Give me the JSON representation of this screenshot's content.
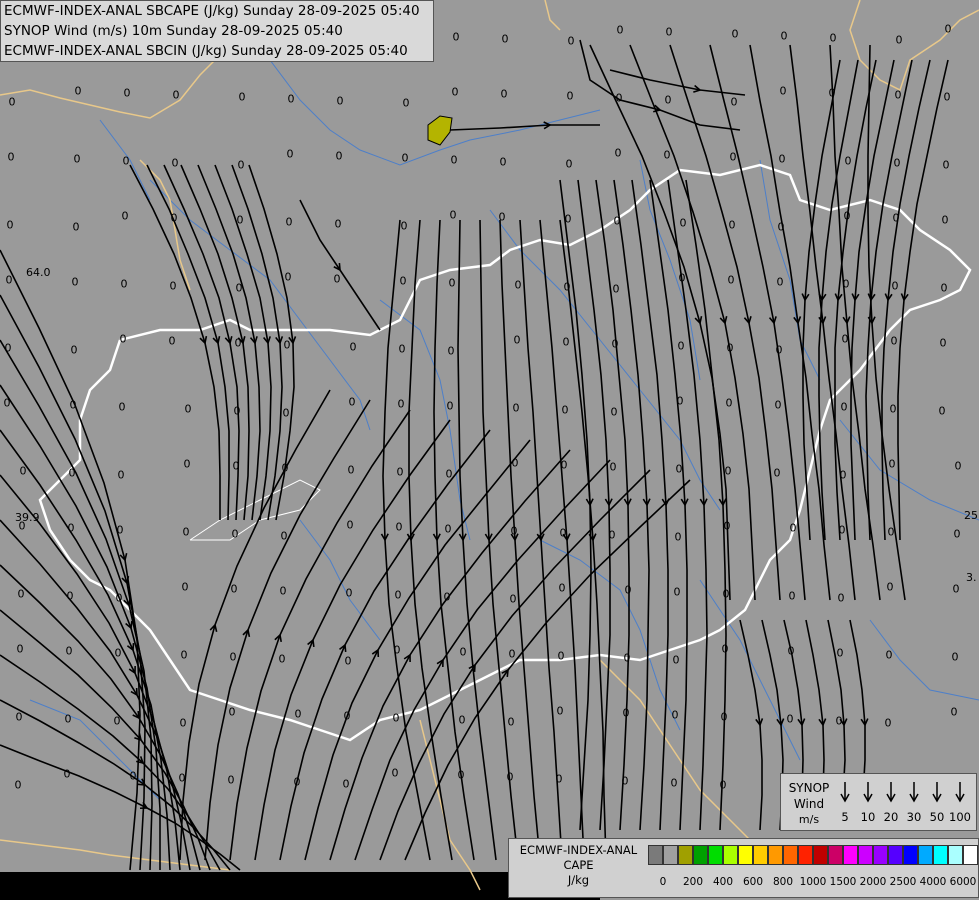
{
  "header": {
    "line1": "ECMWF-INDEX-ANAL SBCAPE (J/kg) Sunday 28-09-2025 05:40",
    "line2": "SYNOP Wind (m/s) 10m Sunday 28-09-2025 05:40",
    "line3": "ECMWF-INDEX-ANAL SBCIN (J/kg) Sunday 28-09-2025 05:40"
  },
  "colors": {
    "background": "#9a9a9a",
    "country_border": "#e8c88a",
    "national_border": "#ffffff",
    "river": "#4d7fc9",
    "streamline": "#000000",
    "cape_patch": "#b4b400"
  },
  "field_value": "0",
  "edge_labels": {
    "l1": "64.0",
    "l2": "39.9",
    "r1": "25",
    "r2": "3."
  },
  "synop_legend": {
    "title": "SYNOP",
    "sub": "Wind",
    "unit": "m/s",
    "speeds": [
      "5",
      "10",
      "20",
      "30",
      "50",
      "100"
    ],
    "icon": "wind-arrow-icon"
  },
  "cape_legend": {
    "title": "ECMWF-INDEX-ANAL",
    "sub": "CAPE",
    "unit": "J/kg",
    "scale": [
      "0",
      "200",
      "400",
      "600",
      "800",
      "1000",
      "1500",
      "2000",
      "2500",
      "4000",
      "6000"
    ],
    "colors": [
      "#7a7a7a",
      "#a0a0a0",
      "#a0a000",
      "#00a000",
      "#00dd00",
      "#aaff00",
      "#ffff00",
      "#ffcc00",
      "#ff9900",
      "#ff6600",
      "#ff2200",
      "#c00000",
      "#cc0066",
      "#ff00ff",
      "#cc00ff",
      "#9900ff",
      "#5500ff",
      "#0000ff",
      "#00aaff",
      "#00ffff",
      "#aaffff",
      "#ffffff"
    ]
  }
}
